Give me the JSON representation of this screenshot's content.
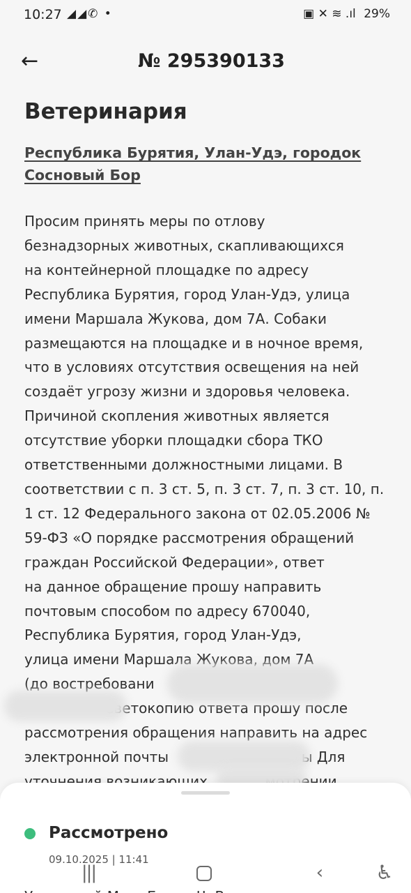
{
  "status_bar": {
    "time": "10:27",
    "left_icons": "◢◢✆ •",
    "right_icons": "▣ ✕ ≋ .ıl",
    "battery": "29%"
  },
  "header": {
    "back_icon": "←",
    "number": "№ 295390133"
  },
  "appeal": {
    "category": "Ветеринария",
    "address": "Республика Бурятия, Улан-Удэ, городок Сосновый Бор",
    "text_lines": [
      "Просим принять меры по отлову",
      "безнадзорных животных, скапливающихся",
      "на контейнерной площадке по адресу",
      "Республика Бурятия, город Улан-Удэ, улица",
      "имени Маршала Жукова, дом 7А. Собаки",
      "размещаются на площадке и в ночное время,",
      "что в условиях отсутствия освещения на ней",
      "создаёт угрозу жизни и здоровья человека.",
      "Причиной скопления животных является",
      "отсутствие уборки площадки сбора ТКО",
      "ответственными должностными лицами. В",
      "соответствии с п. 3 ст. 5, п. 3 ст. 7, п. 3 ст. 10, п.",
      "1 ст. 12 Федерального закона от 02.05.2006 №",
      "59-ФЗ «О порядке рассмотрения обращений",
      "граждан Российской Федерации», ответ",
      "на данное обращение прошу направить",
      "почтовым способом по адресу 670040,",
      "Республика Бурятия, город Улан-Удэ,",
      "улица имени Маршала Жукова, дом 7А",
      "(до востребовани",
      "                  Светокопию ответа прошу после",
      "рассмотрения обращения направить на адрес",
      "электронной почты                              ы Для",
      "уточнения возникающих             мотрении"
    ],
    "cut_line": "Уточнений Мы в Ба... и Ч. В"
  },
  "status": {
    "color": "#3dbd7d",
    "label": "Рассмотрено",
    "date": "09.10.2025 | 11:41"
  },
  "nav": {
    "recents": "|||",
    "back": "‹",
    "accessibility": "♿"
  }
}
